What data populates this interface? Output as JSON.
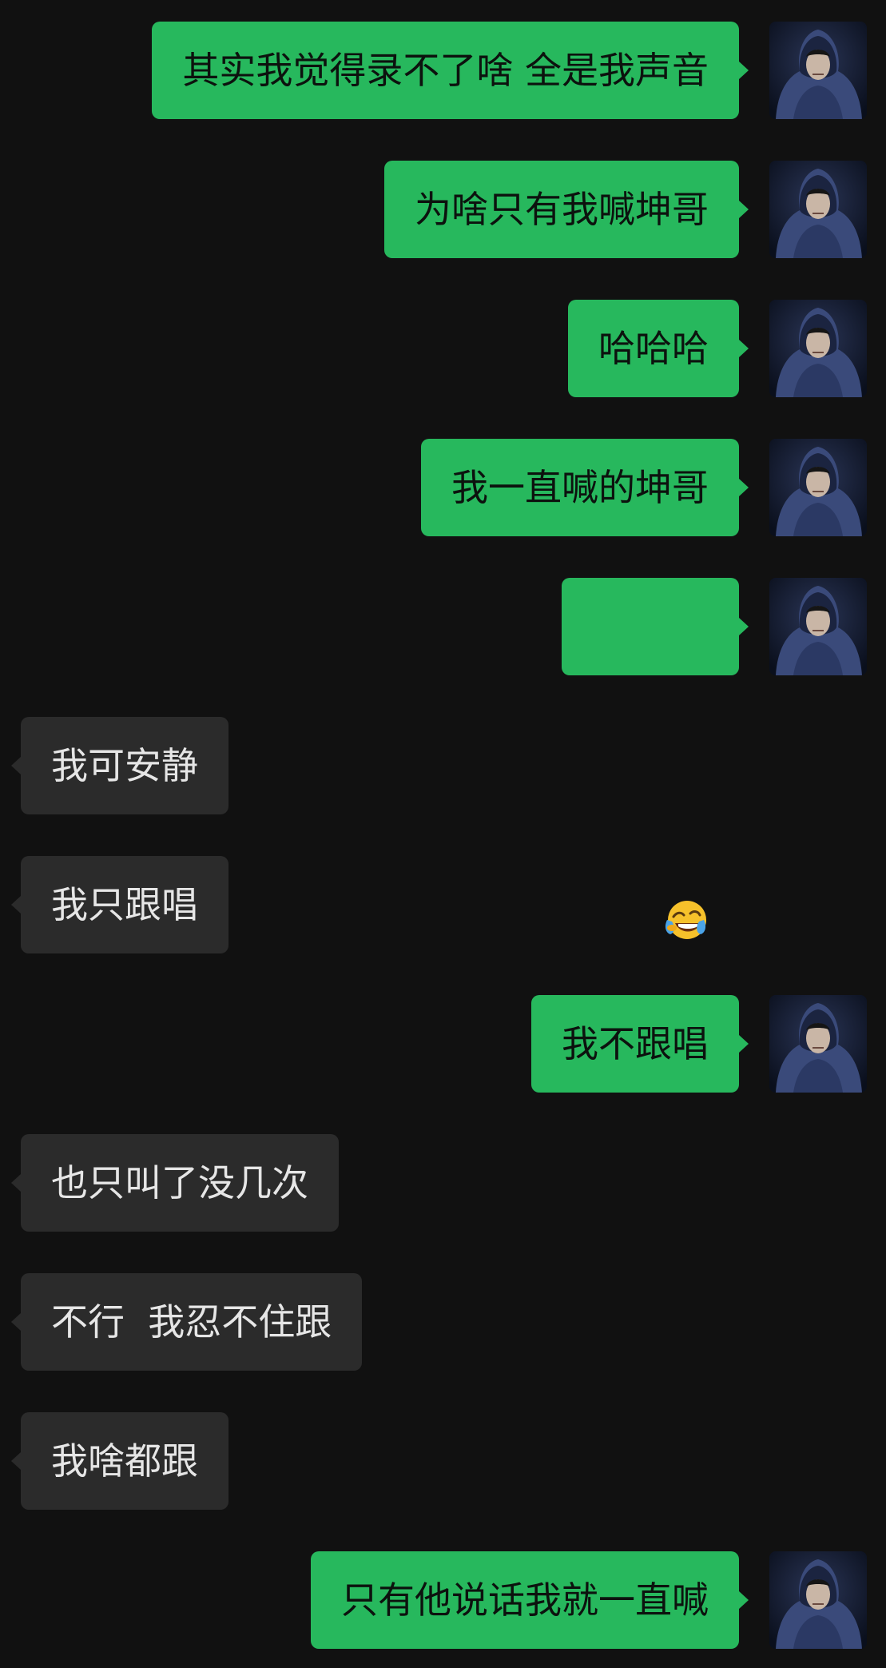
{
  "messages": [
    {
      "sender": "me",
      "text": "其实我觉得录不了啥 全是我声音"
    },
    {
      "sender": "me",
      "text": "为啥只有我喊坤哥"
    },
    {
      "sender": "me",
      "text": "哈哈哈"
    },
    {
      "sender": "me",
      "text": "我一直喊的坤哥"
    },
    {
      "sender": "me",
      "text": "",
      "emoji": "laughing-crying-emoji"
    },
    {
      "sender": "other",
      "text": "我可安静"
    },
    {
      "sender": "other",
      "text": "我只跟唱"
    },
    {
      "sender": "me",
      "text": "我不跟唱"
    },
    {
      "sender": "other",
      "text": "也只叫了没几次"
    },
    {
      "sender": "other",
      "text": "不行  我忍不住跟"
    },
    {
      "sender": "other",
      "text": "我啥都跟"
    },
    {
      "sender": "me",
      "text": "只有他说话我就一直喊"
    }
  ],
  "avatar": {
    "icon": "hooded-figure-avatar"
  },
  "colors": {
    "background": "#111111",
    "outgoing_bubble": "#27b85d",
    "incoming_bubble": "#2b2b2b"
  }
}
